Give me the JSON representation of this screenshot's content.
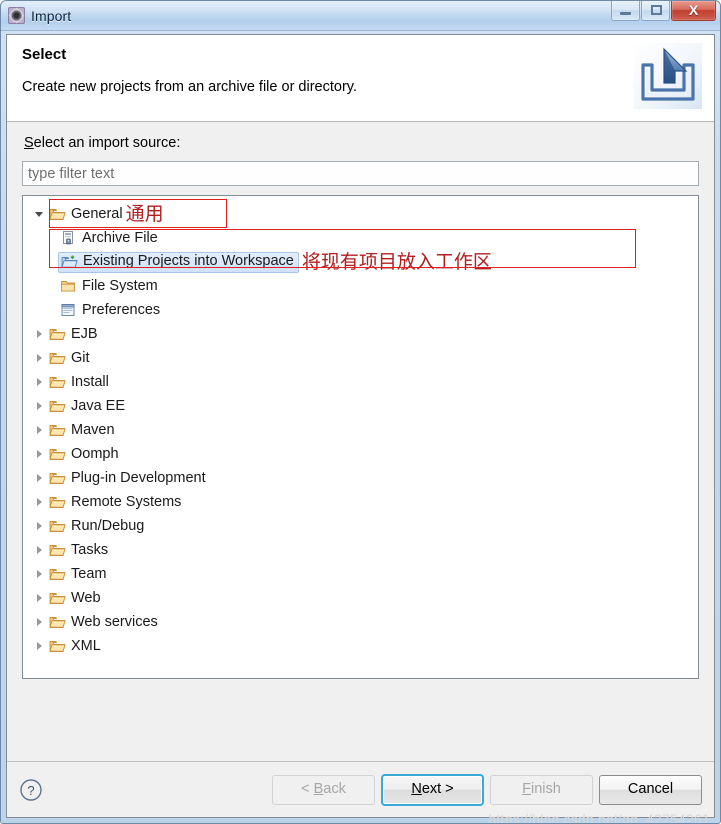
{
  "window": {
    "title": "Import",
    "title_icon": "import-gear-icon",
    "controls": {
      "minimize": "minimize-icon",
      "maximize": "maximize-icon",
      "close": "X"
    }
  },
  "header": {
    "title": "Select",
    "description": "Create new projects from an archive file or directory.",
    "icon": "import-arrow-into-tray-icon"
  },
  "body": {
    "source_label_mnemonic": "S",
    "source_label_rest": "elect an import source:",
    "filter": {
      "placeholder": "type filter text",
      "value": ""
    }
  },
  "tree": {
    "items": [
      {
        "label": "General",
        "icon": "open-folder-icon",
        "state": "expanded",
        "level": 0,
        "annotation": "通用",
        "boxed": true
      },
      {
        "label": "Archive File",
        "icon": "archive-file-icon",
        "state": "leaf",
        "level": 1
      },
      {
        "label": "Existing Projects into Workspace",
        "icon": "project-folder-icon",
        "state": "leaf",
        "level": 1,
        "selected": true,
        "annotation": "将现有项目放入工作区"
      },
      {
        "label": "File System",
        "icon": "folder-icon",
        "state": "leaf",
        "level": 1
      },
      {
        "label": "Preferences",
        "icon": "preferences-icon",
        "state": "leaf",
        "level": 1
      },
      {
        "label": "EJB",
        "icon": "open-folder-icon",
        "state": "collapsed",
        "level": 0
      },
      {
        "label": "Git",
        "icon": "open-folder-icon",
        "state": "collapsed",
        "level": 0
      },
      {
        "label": "Install",
        "icon": "open-folder-icon",
        "state": "collapsed",
        "level": 0
      },
      {
        "label": "Java EE",
        "icon": "open-folder-icon",
        "state": "collapsed",
        "level": 0
      },
      {
        "label": "Maven",
        "icon": "open-folder-icon",
        "state": "collapsed",
        "level": 0
      },
      {
        "label": "Oomph",
        "icon": "open-folder-icon",
        "state": "collapsed",
        "level": 0
      },
      {
        "label": "Plug-in Development",
        "icon": "open-folder-icon",
        "state": "collapsed",
        "level": 0
      },
      {
        "label": "Remote Systems",
        "icon": "open-folder-icon",
        "state": "collapsed",
        "level": 0
      },
      {
        "label": "Run/Debug",
        "icon": "open-folder-icon",
        "state": "collapsed",
        "level": 0
      },
      {
        "label": "Tasks",
        "icon": "open-folder-icon",
        "state": "collapsed",
        "level": 0
      },
      {
        "label": "Team",
        "icon": "open-folder-icon",
        "state": "collapsed",
        "level": 0
      },
      {
        "label": "Web",
        "icon": "open-folder-icon",
        "state": "collapsed",
        "level": 0
      },
      {
        "label": "Web services",
        "icon": "open-folder-icon",
        "state": "collapsed",
        "level": 0
      },
      {
        "label": "XML",
        "icon": "open-folder-icon",
        "state": "collapsed",
        "level": 0
      }
    ]
  },
  "footer": {
    "help_icon": "question-mark-help-icon",
    "buttons": [
      {
        "name": "back",
        "prefix": "< ",
        "mnemonic": "B",
        "suffix": "ack",
        "state": "disabled"
      },
      {
        "name": "next",
        "prefix": "",
        "mnemonic": "N",
        "suffix": "ext >",
        "state": "default"
      },
      {
        "name": "finish",
        "prefix": "",
        "mnemonic": "F",
        "suffix": "inish",
        "state": "disabled"
      },
      {
        "name": "cancel",
        "prefix": "",
        "mnemonic": "",
        "suffix": "Cancel",
        "state": "normal"
      }
    ]
  },
  "watermark": "https://blog.csdn.net/qq_42754261",
  "colors": {
    "accent_blue": "#3aa8d8",
    "annotation_red": "#e02020",
    "selection_blue": "#cfe2f8",
    "titlebar_blue": "#bed7f0"
  }
}
